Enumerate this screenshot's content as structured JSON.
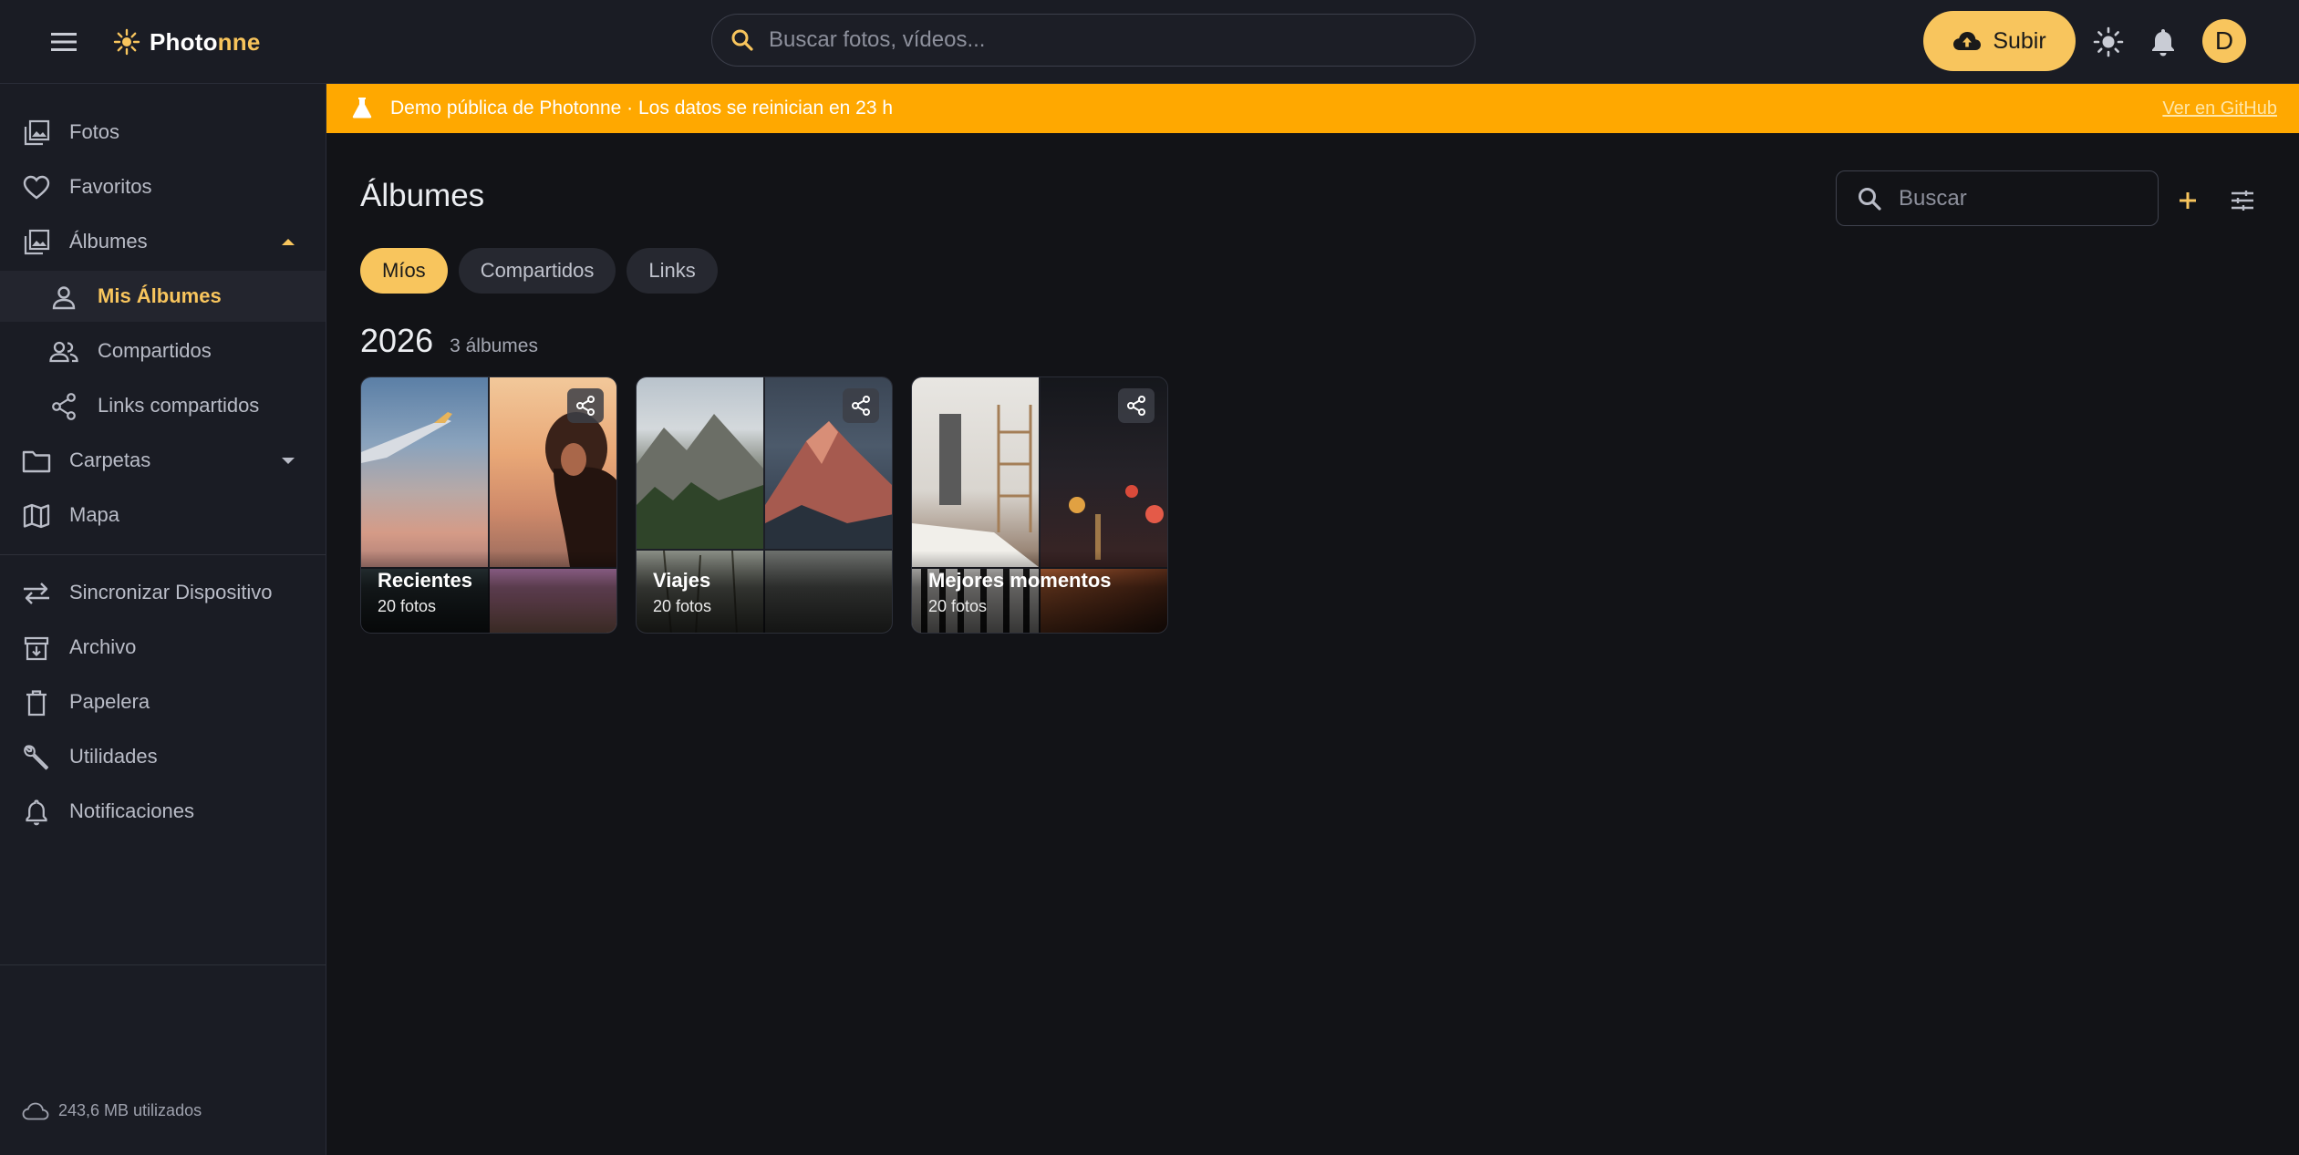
{
  "header": {
    "brand_prefix": "Photo",
    "brand_suffix": "nne",
    "search_placeholder": "Buscar fotos, vídeos...",
    "upload_label": "Subir",
    "avatar_initial": "D"
  },
  "sidebar": {
    "items": [
      {
        "label": "Fotos",
        "icon": "photos-icon"
      },
      {
        "label": "Favoritos",
        "icon": "heart-icon"
      },
      {
        "label": "Álbumes",
        "icon": "albums-icon",
        "expanded": true
      },
      {
        "label": "Mis Álbumes",
        "icon": "person-icon",
        "active": true
      },
      {
        "label": "Compartidos",
        "icon": "people-icon"
      },
      {
        "label": "Links compartidos",
        "icon": "share-icon"
      },
      {
        "label": "Carpetas",
        "icon": "folder-icon",
        "expanded": false
      },
      {
        "label": "Mapa",
        "icon": "map-icon"
      },
      {
        "label": "Sincronizar Dispositivo",
        "icon": "sync-icon"
      },
      {
        "label": "Archivo",
        "icon": "archive-icon"
      },
      {
        "label": "Papelera",
        "icon": "trash-icon"
      },
      {
        "label": "Utilidades",
        "icon": "wrench-icon"
      },
      {
        "label": "Notificaciones",
        "icon": "bell-icon"
      }
    ],
    "storage": "243,6 MB utilizados"
  },
  "banner": {
    "text": "Demo pública de Photonne · Los datos se reinician en 23 h",
    "link": "Ver en GitHub",
    "color": "#ffa800"
  },
  "main": {
    "title": "Álbumes",
    "search_placeholder": "Buscar",
    "tabs": [
      {
        "label": "Míos",
        "active": true
      },
      {
        "label": "Compartidos",
        "active": false
      },
      {
        "label": "Links",
        "active": false
      }
    ],
    "year": "2026",
    "year_count": "3 álbumes",
    "albums": [
      {
        "name": "Recientes",
        "count": "20 fotos"
      },
      {
        "name": "Viajes",
        "count": "20 fotos"
      },
      {
        "name": "Mejores momentos",
        "count": "20 fotos"
      }
    ]
  },
  "colors": {
    "accent": "#f8c55d",
    "background": "#121317",
    "surface": "#1a1c24"
  }
}
